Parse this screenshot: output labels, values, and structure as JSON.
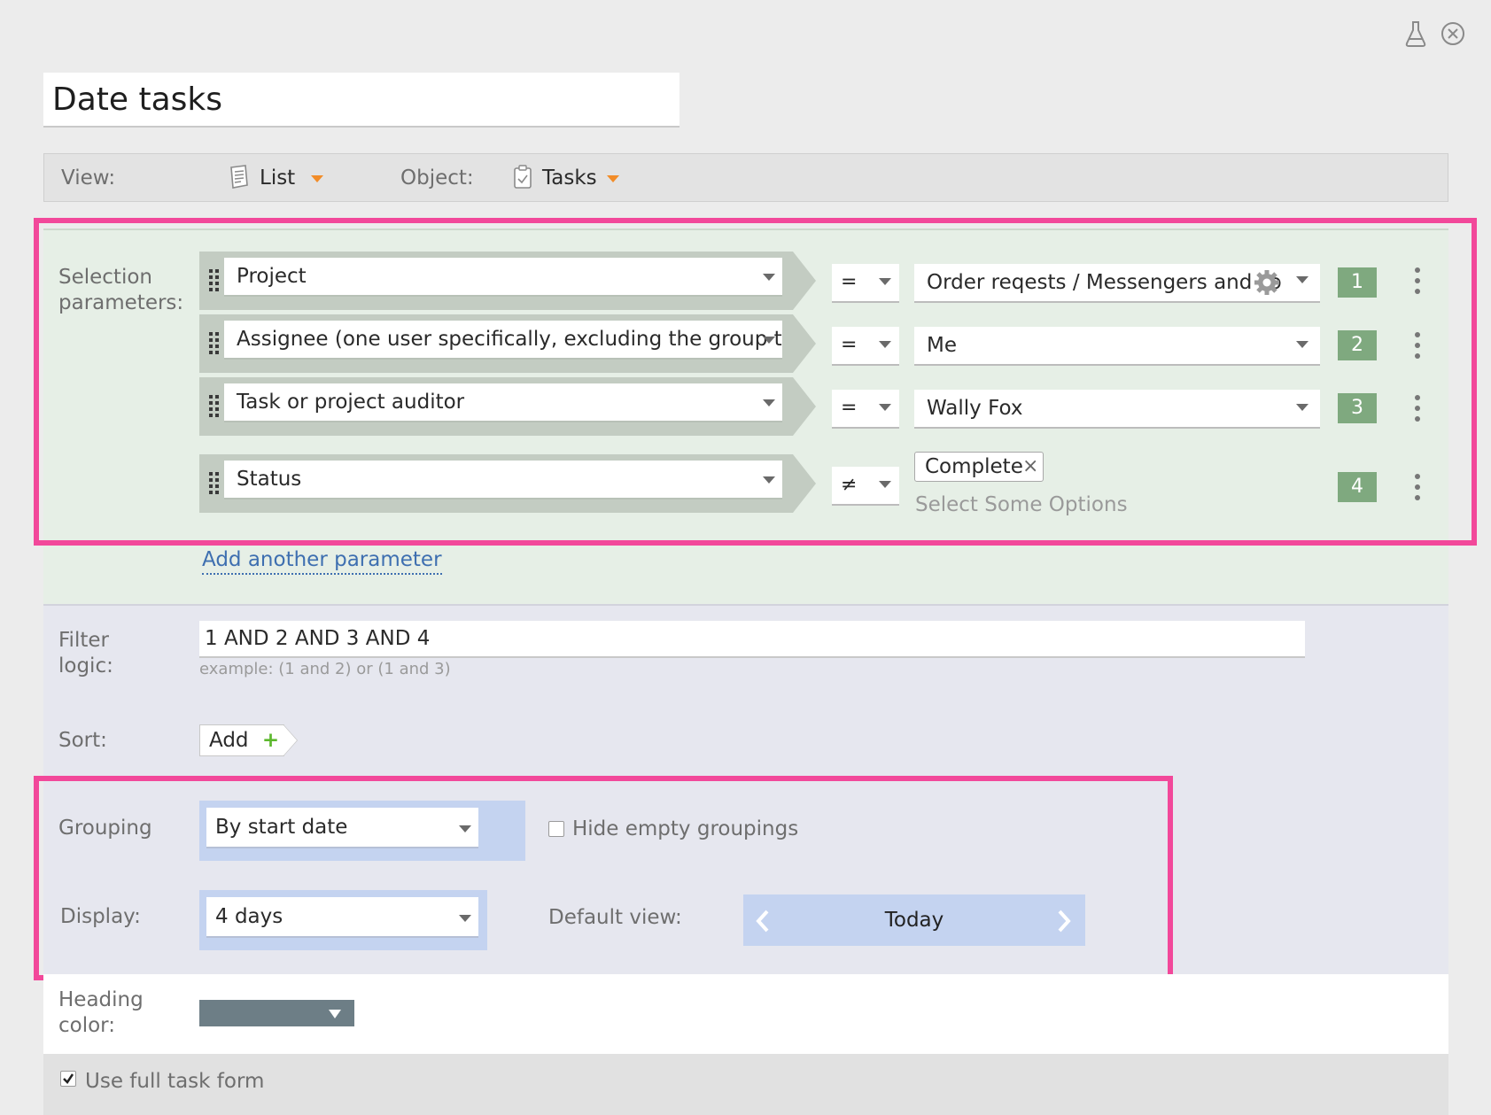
{
  "window": {
    "icons": [
      "flask-icon",
      "close-circle-icon"
    ]
  },
  "title": "Date tasks",
  "viewbar": {
    "view_label": "View:",
    "view_value": "List",
    "object_label": "Object:",
    "object_value": "Tasks"
  },
  "selection": {
    "label_line1": "Selection",
    "label_line2": "parameters:",
    "params": [
      {
        "field": "Project",
        "op": "=",
        "value": "Order reqests / Messengers and so",
        "num": "1"
      },
      {
        "field": "Assignee (one user specifically, excluding the group they",
        "op": "=",
        "value": "Me",
        "num": "2"
      },
      {
        "field": "Task or project auditor",
        "op": "=",
        "value": "Wally Fox",
        "num": "3"
      },
      {
        "field": "Status",
        "op": "≠",
        "tag": "Complete",
        "tag_remove": "×",
        "placeholder": "Select Some Options",
        "num": "4"
      }
    ],
    "add_link": "Add another parameter"
  },
  "filter": {
    "label_line1": "Filter",
    "label_line2": "logic:",
    "value": "1 AND 2 AND 3 AND 4",
    "hint": "example: (1 and 2) or (1 and 3)"
  },
  "sort": {
    "label": "Sort:",
    "add_label": "Add",
    "add_icon": "+"
  },
  "grouping": {
    "label": "Grouping",
    "value": "By start date",
    "hide_empty_label": "Hide empty groupings",
    "hide_empty_checked": false
  },
  "display": {
    "label": "Display:",
    "value": "4 days",
    "default_view_label": "Default view:",
    "default_view_value": "Today"
  },
  "heading_color": {
    "label_line1": "Heading",
    "label_line2": "color:",
    "color": "#6d7e86"
  },
  "full_form": {
    "label": "Use full task form",
    "checked": true
  },
  "colors": {
    "accent_orange": "#f28c28",
    "highlight_pink": "#f2489a",
    "badge_green": "#7fa97f",
    "selection_bg": "#e6efe6",
    "lower_bg": "#e6e7ef",
    "blue_wrap": "#c4d3f0"
  }
}
